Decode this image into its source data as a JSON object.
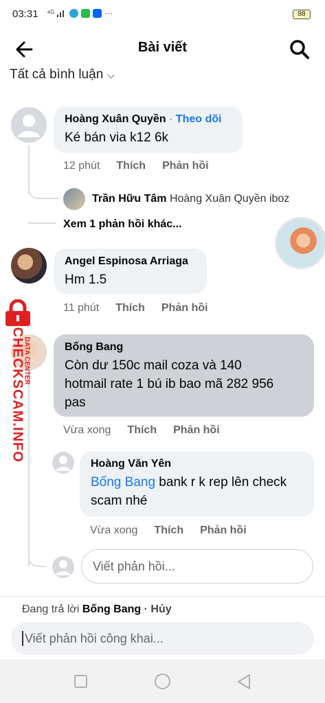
{
  "status_bar": {
    "time": "03:31",
    "icons_text": "⁴ᴳ",
    "battery": "88"
  },
  "header": {
    "title": "Bài viết"
  },
  "filter": {
    "label": "Tất cả bình luận"
  },
  "comments": [
    {
      "author": "Hoàng Xuân Quyền",
      "separator": " · ",
      "follow_label": "Theo dõi",
      "text": "Ké bán via k12 6k",
      "time": "12 phút",
      "like": "Thích",
      "reply": "Phản hồi",
      "reply_preview": {
        "author": "Trần Hữu Tâm",
        "text": "Hoàng Xuân Quyền iboz"
      },
      "more_replies": "Xem 1 phản hồi khác..."
    },
    {
      "author": "Angel Espinosa Arriaga",
      "text": "Hm 1.5",
      "time": "11 phút",
      "like": "Thích",
      "reply": "Phản hồi"
    },
    {
      "author": "Bống Bang",
      "text_lines": [
        "Còn dư 150c mail coza và 140",
        "hotmail rate 1 bú ib bao mã 282 956",
        "pas"
      ],
      "time": "Vừa xong",
      "like": "Thích",
      "reply": "Phản hồi",
      "reply_item": {
        "author": "Hoàng Văn Yên",
        "mention": "Bống Bang",
        "text_line1": " bank r k rep lên check",
        "text_line2": "scam nhé",
        "time": "Vừa xong",
        "like": "Thích",
        "reply": "Phản hồi"
      }
    }
  ],
  "inline_reply": {
    "placeholder": "Viết phản hồi..."
  },
  "replying_bar": {
    "prefix": "Đang trả lời ",
    "name": "Bống Bang",
    "cancel": " · Hủy"
  },
  "public_reply": {
    "placeholder": "Viết phản hồi công khai..."
  },
  "watermark": {
    "brand": "CHECKSCAM.INFO",
    "sub": "DATA CENTER"
  },
  "colors": {
    "accent": "#1877f2",
    "watermark": "#e02020"
  }
}
